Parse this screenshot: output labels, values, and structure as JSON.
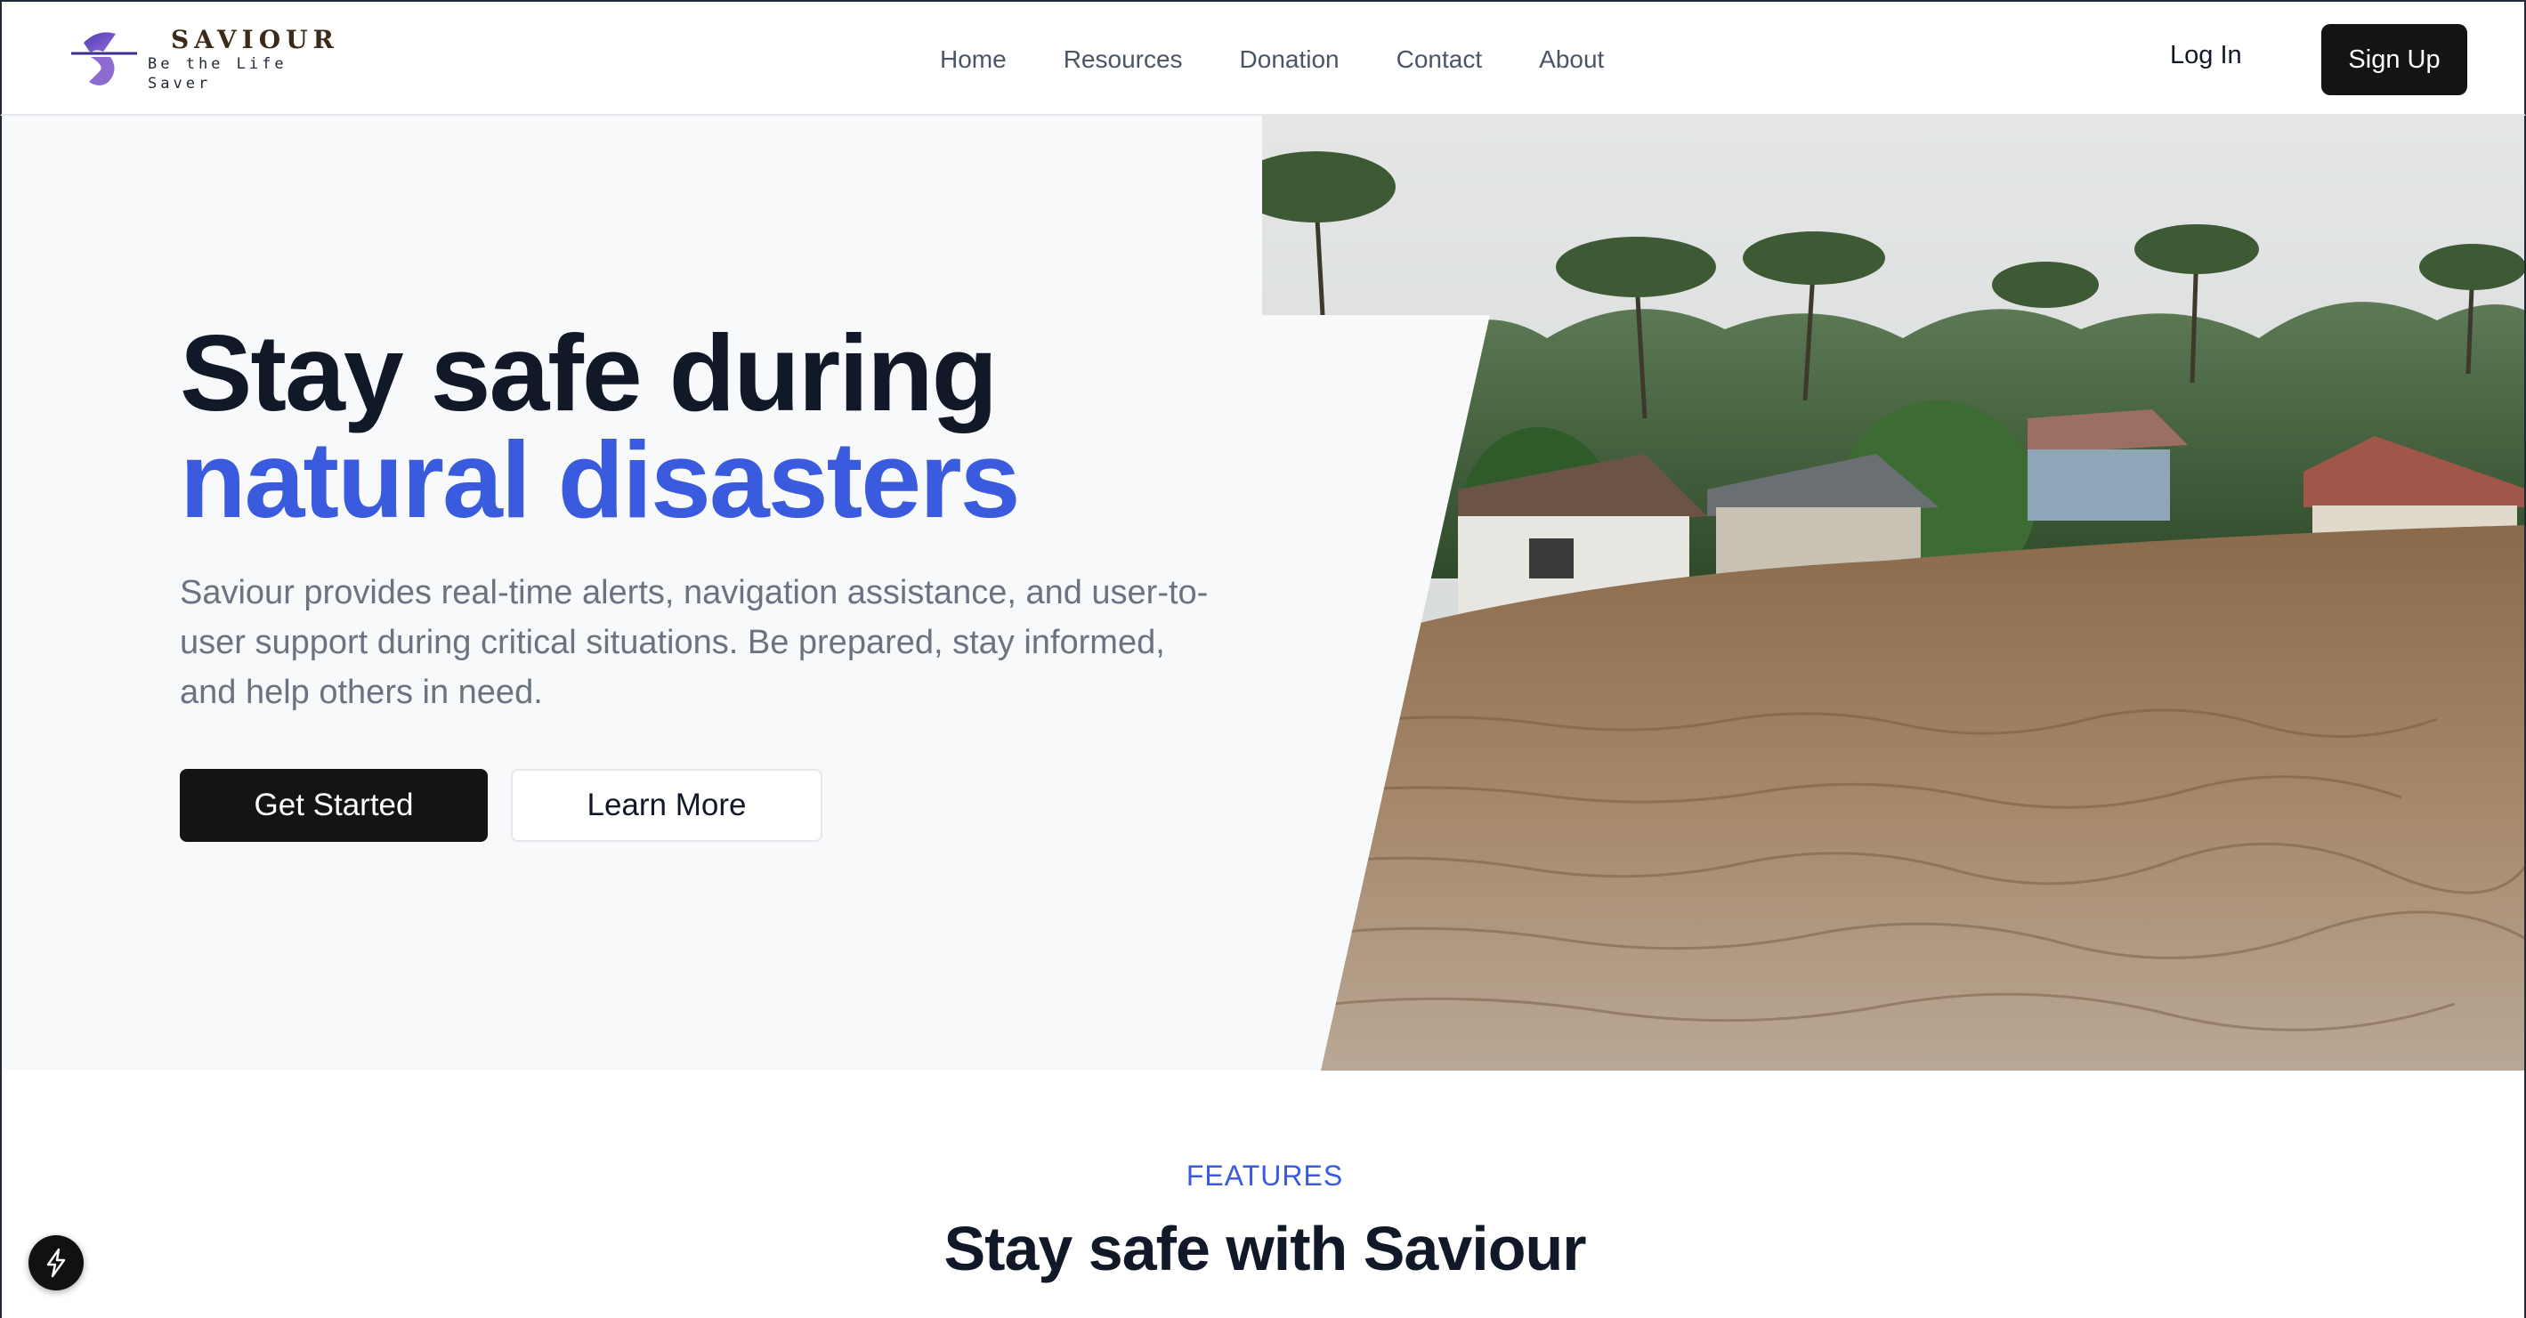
{
  "brand": {
    "name": "SAVIOUR",
    "tagline": "Be the Life Saver"
  },
  "nav": {
    "items": [
      {
        "label": "Home"
      },
      {
        "label": "Resources"
      },
      {
        "label": "Donation"
      },
      {
        "label": "Contact"
      },
      {
        "label": "About"
      }
    ]
  },
  "auth": {
    "login_label": "Log In",
    "signup_label": "Sign Up"
  },
  "hero": {
    "title_line1": "Stay safe during",
    "title_line2": "natural disasters",
    "description": "Saviour provides real-time alerts, navigation assistance, and user-to-user support during critical situations. Be prepared, stay informed, and help others in need.",
    "primary_cta": "Get Started",
    "secondary_cta": "Learn More",
    "image_icon": "flooded-village-photo"
  },
  "features": {
    "eyebrow": "FEATURES",
    "title": "Stay safe with Saviour"
  },
  "fab": {
    "icon": "lightning-bolt-icon"
  },
  "colors": {
    "accent": "#3a5bdd",
    "dark": "#141414",
    "muted_text": "#6b7280",
    "hero_bg": "#f8f9fb"
  }
}
